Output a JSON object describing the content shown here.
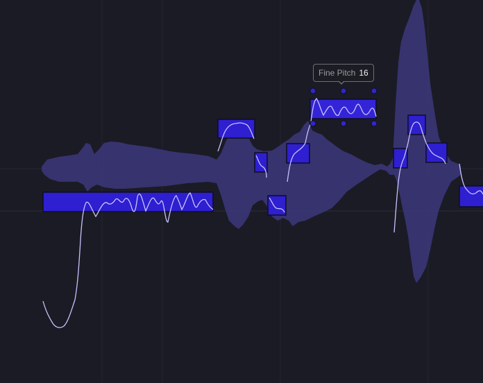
{
  "tooltip": {
    "label": "Fine Pitch",
    "value": "16"
  },
  "colors": {
    "background": "#1b1b25",
    "grid_line": "#2a2a36",
    "waveform": "#3b3678",
    "note_fill": "#2e1fd0",
    "note_fill_selected": "#3424d8",
    "note_border": "#0e0c26",
    "pitch_curve": "#c9c3ff",
    "handle": "#3226c4"
  },
  "icons": {
    "note_handle": "circle-handle-icon"
  }
}
